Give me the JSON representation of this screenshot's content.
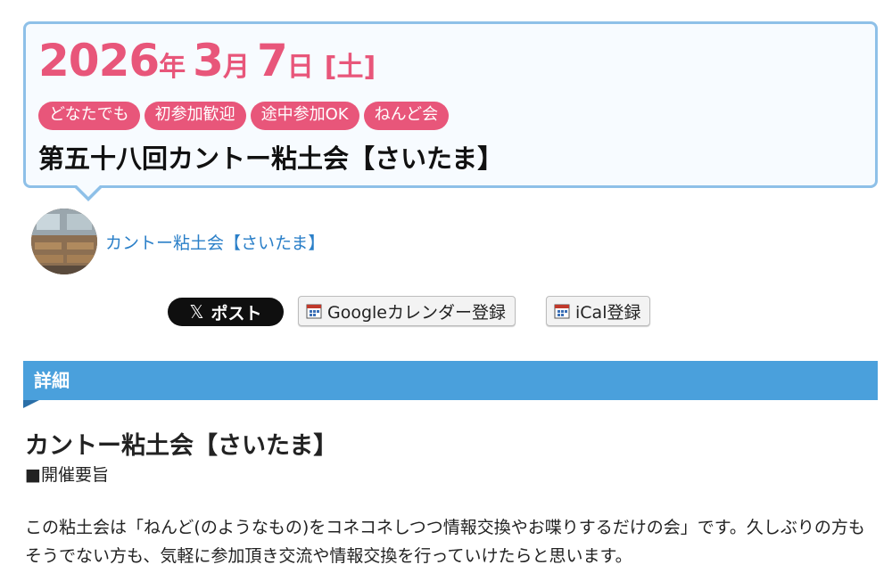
{
  "event": {
    "year": "2026",
    "year_unit": "年",
    "month": "3",
    "month_unit": "月",
    "day": "7",
    "day_unit": "日",
    "weekday": "[土]",
    "tags": [
      "どなたでも",
      "初参加歓迎",
      "途中参加OK",
      "ねんど会"
    ],
    "title": "第五十八回カントー粘土会【さいたま】"
  },
  "organizer": {
    "name": "カントー粘土会【さいたま】"
  },
  "share": {
    "x_post_label": "ポスト",
    "google_calendar_label": "Googleカレンダー登録",
    "ical_label": "iCal登録"
  },
  "details": {
    "section_title": "詳細",
    "heading": "カントー粘土会【さいたま】",
    "subheading": "■開催要旨",
    "body": "この粘土会は「ねんど(のようなもの)をコネコネしつつ情報交換やお喋りするだけの会」です。久しぶりの方もそうでない方も、気軽に参加頂き交流や情報交換を行っていけたらと思います。"
  },
  "colors": {
    "accent_pink": "#e8567a",
    "link_blue": "#2a7fc8",
    "section_blue": "#4aa0dc",
    "card_border": "#8ec0e8"
  }
}
